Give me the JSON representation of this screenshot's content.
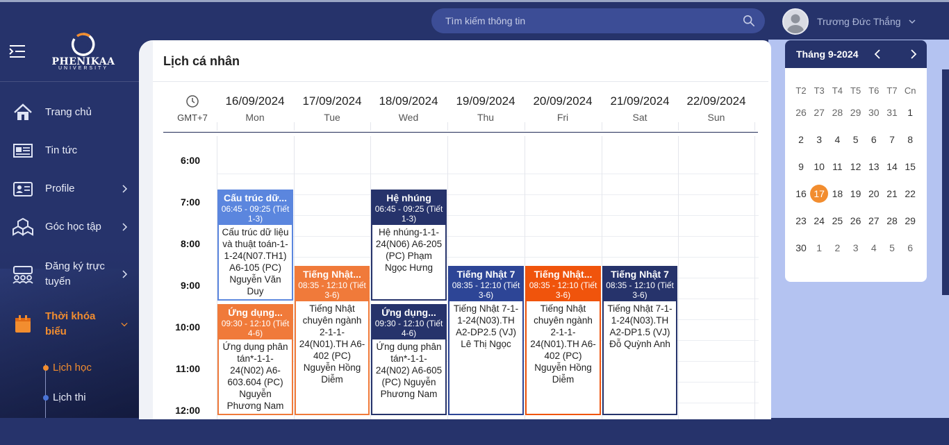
{
  "search": {
    "placeholder": "Tìm kiếm thông tin"
  },
  "user": {
    "name": "Trương Đức Thắng"
  },
  "logo": {
    "name": "PHENIKAA",
    "sub": "UNIVERSITY"
  },
  "sidebar": {
    "items": [
      {
        "label": "Trang chủ",
        "icon": "home-icon"
      },
      {
        "label": "Tin tức",
        "icon": "news-icon"
      },
      {
        "label": "Profile",
        "icon": "profile-icon"
      },
      {
        "label": "Góc học tập",
        "icon": "cubes-icon"
      },
      {
        "label": "Đăng ký trực tuyến",
        "icon": "group-icon"
      },
      {
        "label": "Thời khóa biểu",
        "icon": "calendar-icon"
      }
    ],
    "subitems": [
      {
        "label": "Lịch học"
      },
      {
        "label": "Lịch thi"
      }
    ]
  },
  "page": {
    "title": "Lịch cá nhân"
  },
  "calendar": {
    "timezone": "GMT+7",
    "days": [
      {
        "date": "16/09/2024",
        "weekday": "Mon"
      },
      {
        "date": "17/09/2024",
        "weekday": "Tue"
      },
      {
        "date": "18/09/2024",
        "weekday": "Wed"
      },
      {
        "date": "19/09/2024",
        "weekday": "Thu"
      },
      {
        "date": "20/09/2024",
        "weekday": "Fri"
      },
      {
        "date": "21/09/2024",
        "weekday": "Sat"
      },
      {
        "date": "22/09/2024",
        "weekday": "Sun"
      }
    ],
    "hours": [
      "6:00",
      "7:00",
      "8:00",
      "9:00",
      "10:00",
      "11:00",
      "12:00"
    ],
    "events": [
      {
        "title": "Cấu trúc dữ...",
        "time": "06:45 - 09:25 (Tiết 1-3)",
        "body": "Cấu trúc dữ liệu và thuật toán-1-1-24(N07.TH1) A6-105 (PC) Nguyễn Văn Duy",
        "color": "#5b86de"
      },
      {
        "title": "Hệ nhúng",
        "time": "06:45 - 09:25 (Tiết 1-3)",
        "body": "Hệ nhúng-1-1-24(N06) A6-205 (PC) Phạm Ngọc Hưng",
        "color": "#26336b"
      },
      {
        "title": "Tiếng Nhật...",
        "time": "08:35 - 12:10 (Tiết 3-6)",
        "body": "Tiếng Nhật chuyên ngành 2-1-1-24(N01).TH A6-402 (PC) Nguyễn Hồng Diễm",
        "color": "#f07a3a"
      },
      {
        "title": "Tiếng Nhật 7",
        "time": "08:35 - 12:10 (Tiết 3-6)",
        "body": "Tiếng Nhật 7-1-1-24(N03).TH A2-DP2.5 (VJ) Lê Thị Ngọc",
        "color": "#2d4596"
      },
      {
        "title": "Tiếng Nhật...",
        "time": "08:35 - 12:10 (Tiết 3-6)",
        "body": "Tiếng Nhật chuyên ngành 2-1-1-24(N01).TH A6-402 (PC) Nguyễn Hồng Diễm",
        "color": "#f0540c"
      },
      {
        "title": "Tiếng Nhật 7",
        "time": "08:35 - 12:10 (Tiết 3-6)",
        "body": "Tiếng Nhật 7-1-1-24(N03).TH A2-DP1.5 (VJ) Đỗ Quỳnh Anh",
        "color": "#26336b"
      },
      {
        "title": "Ứng dụng...",
        "time": "09:30 - 12:10 (Tiết 4-6)",
        "body": "Ứng dụng phân tán*-1-1-24(N02) A6-603.604 (PC) Nguyễn Phương Nam",
        "color": "#f07a3a"
      },
      {
        "title": "Ứng dụng...",
        "time": "09:30 - 12:10 (Tiết 4-6)",
        "body": "Ứng dụng phân tán*-1-1-24(N02) A6-605 (PC) Nguyễn Phương Nam",
        "color": "#26336b"
      }
    ]
  },
  "minical": {
    "title": "Tháng 9-2024",
    "weekdays": [
      "T2",
      "T3",
      "T4",
      "T5",
      "T6",
      "T7",
      "Cn"
    ],
    "weeks": [
      [
        "26",
        "27",
        "28",
        "29",
        "30",
        "31",
        "1"
      ],
      [
        "2",
        "3",
        "4",
        "5",
        "6",
        "7",
        "8"
      ],
      [
        "9",
        "10",
        "11",
        "12",
        "13",
        "14",
        "15"
      ],
      [
        "16",
        "17",
        "18",
        "19",
        "20",
        "21",
        "22"
      ],
      [
        "23",
        "24",
        "25",
        "26",
        "27",
        "28",
        "29"
      ],
      [
        "30",
        "1",
        "2",
        "3",
        "4",
        "5",
        "6"
      ]
    ],
    "today": "17"
  }
}
